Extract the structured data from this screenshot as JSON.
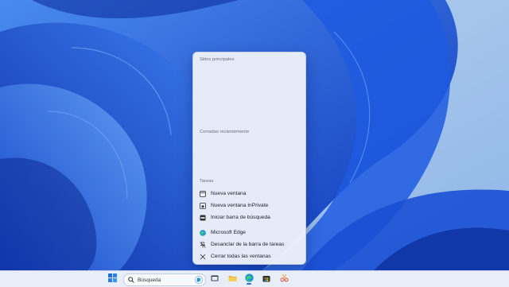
{
  "jumplist": {
    "pinned_header": "Sitios principales",
    "recent_header": "Cerradas recientemente",
    "tasks_header": "Tareas",
    "tasks": [
      {
        "label": "Nueva ventana",
        "icon": "window-icon"
      },
      {
        "label": "Nueva ventana InPrivate",
        "icon": "inprivate-icon"
      },
      {
        "label": "Iniciar barra de búsqueda",
        "icon": "search-bar-icon"
      }
    ],
    "app_actions": [
      {
        "label": "Microsoft Edge",
        "icon": "edge-icon"
      },
      {
        "label": "Desanclar de la barra de tareas",
        "icon": "unpin-icon"
      },
      {
        "label": "Cerrar todas las ventanas",
        "icon": "close-icon"
      }
    ]
  },
  "taskbar": {
    "search_placeholder": "Búsqueda",
    "pinned": [
      "start-icon",
      "search-icon",
      "copilot-icon",
      "task-view-icon",
      "file-explorer-icon",
      "edge-icon",
      "store-icon",
      "snipping-tool-icon"
    ]
  },
  "colors": {
    "accent": "#2f6fd6",
    "wallpaper_base": "#9cc2ec",
    "wallpaper_bloom": "#1f56d8"
  }
}
